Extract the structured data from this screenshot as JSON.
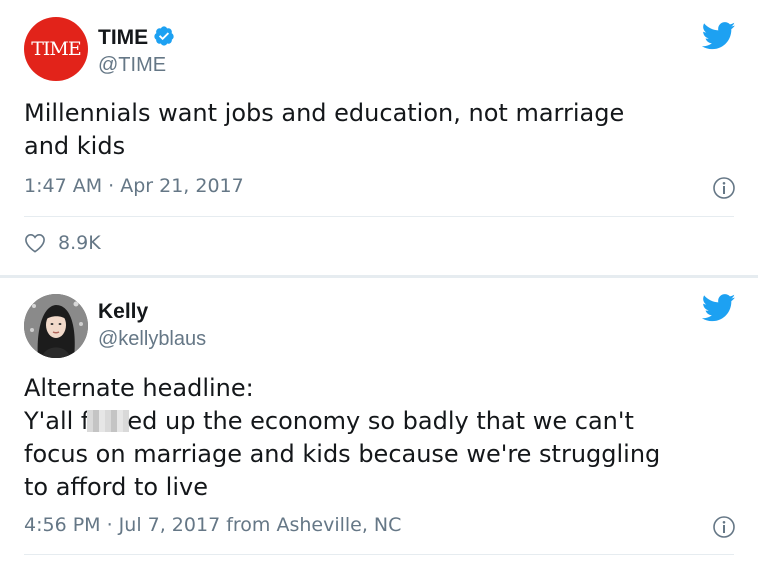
{
  "tweets": [
    {
      "avatar_text": "TIME",
      "name": "TIME",
      "verified": true,
      "handle": "@TIME",
      "text": "Millennials want jobs and education, not marriage\nand kids",
      "meta": "1:47 AM · Apr 21, 2017",
      "likes": "8.9K"
    },
    {
      "name": "Kelly",
      "verified": false,
      "handle": "@kellyblaus",
      "text_line1": "Alternate headline:",
      "text_line2_pre": "Y'all f",
      "text_line2_post": "ed up the economy so badly that we can't",
      "text_rest": "focus on marriage and kids because we're struggling\nto afford to live",
      "meta": "4:56 PM · Jul 7, 2017 from Asheville, NC"
    }
  ],
  "icons": {
    "bird": "twitter-bird-icon",
    "info": "info-icon",
    "heart": "heart-icon",
    "verified": "verified-badge-icon"
  },
  "colors": {
    "twitter_blue": "#1da1f2",
    "time_red": "#e2231a",
    "secondary_text": "#657786"
  }
}
